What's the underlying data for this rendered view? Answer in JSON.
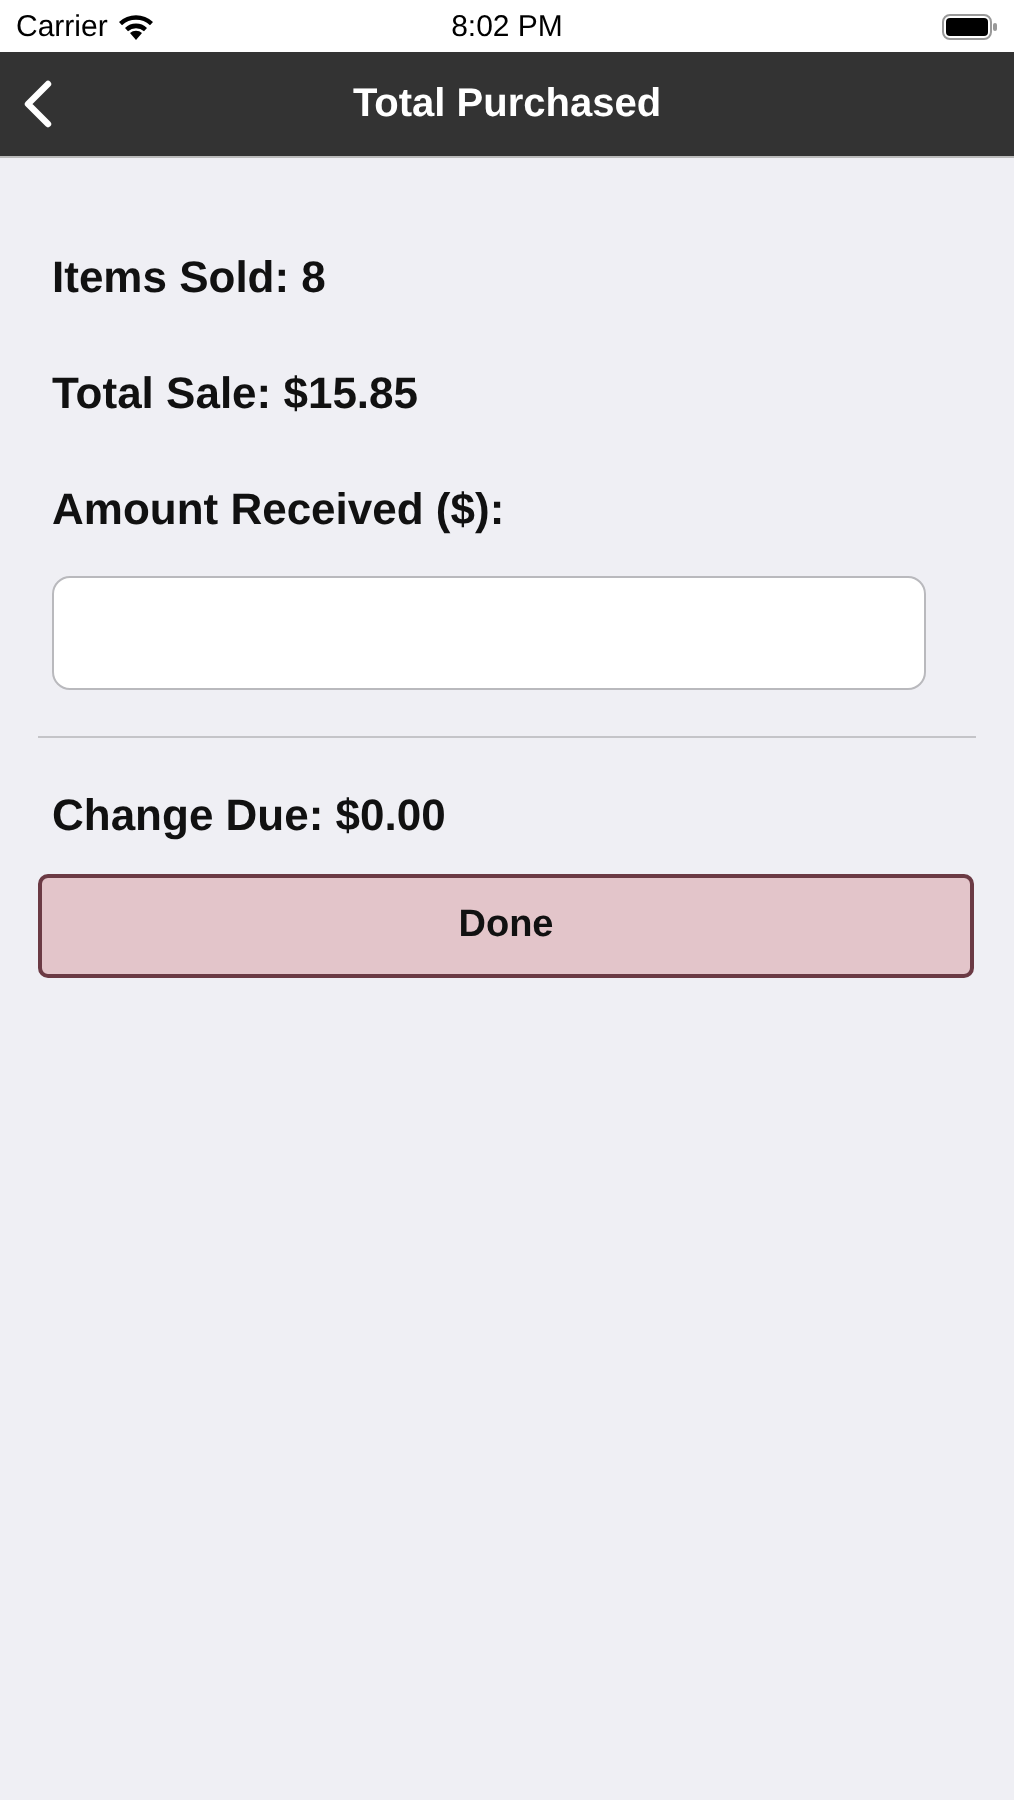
{
  "status_bar": {
    "carrier": "Carrier",
    "time": "8:02 PM"
  },
  "nav_bar": {
    "title": "Total Purchased"
  },
  "summary": [
    {
      "text": "Items Sold: 8"
    },
    {
      "text": "Total Sale: $15.85"
    },
    {
      "text": "Amount Received ($):"
    }
  ],
  "change_due": "Change Due: $0.00",
  "done_button": "Done"
}
